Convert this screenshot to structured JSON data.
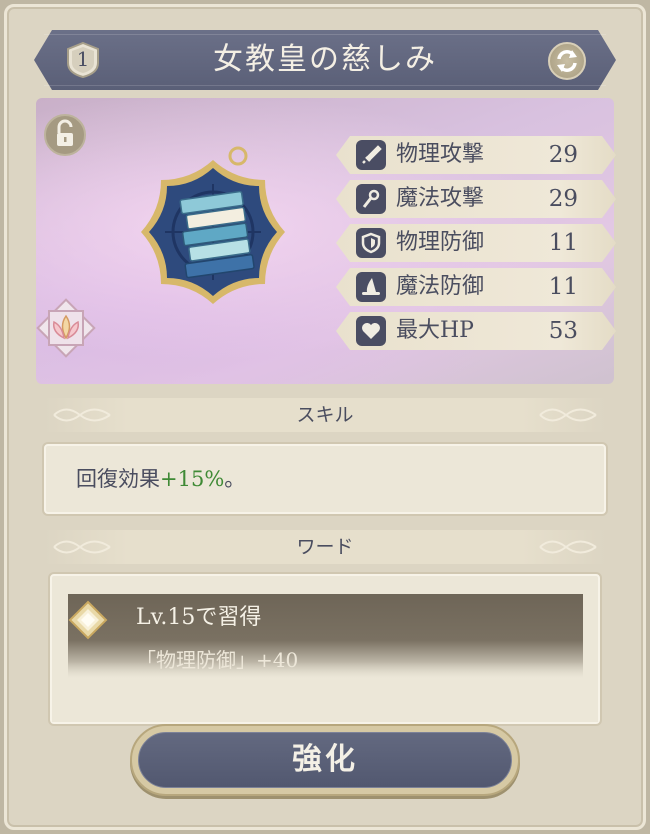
{
  "item": {
    "title": "女教皇の慈しみ",
    "rank": "1"
  },
  "icons": {
    "rank": "shield-badge-icon",
    "swap": "swap-arrows-icon",
    "lock": "padlock-open-icon",
    "element": "lotus-emblem-icon",
    "item": "book-stack-charm-icon"
  },
  "stats": [
    {
      "icon": "sword-icon",
      "label": "物理攻撃",
      "value": "29"
    },
    {
      "icon": "wand-icon",
      "label": "魔法攻撃",
      "value": "29"
    },
    {
      "icon": "shield-icon",
      "label": "物理防御",
      "value": "11"
    },
    {
      "icon": "witch-hat-icon",
      "label": "魔法防御",
      "value": "11"
    },
    {
      "icon": "heart-icon",
      "label": "最大HP",
      "value": "53"
    }
  ],
  "skill": {
    "header": "スキル",
    "text_prefix": "回復効果",
    "text_highlight": "+15%",
    "text_suffix": "。"
  },
  "word": {
    "header": "ワード",
    "entry_title": "Lv.15で習得",
    "entry_detail": "「物理防御」+40"
  },
  "actions": {
    "enhance_label": "強化"
  },
  "colors": {
    "banner": "#5f647c",
    "accent_green": "#3f8a35",
    "text": "#4a4d5f"
  }
}
